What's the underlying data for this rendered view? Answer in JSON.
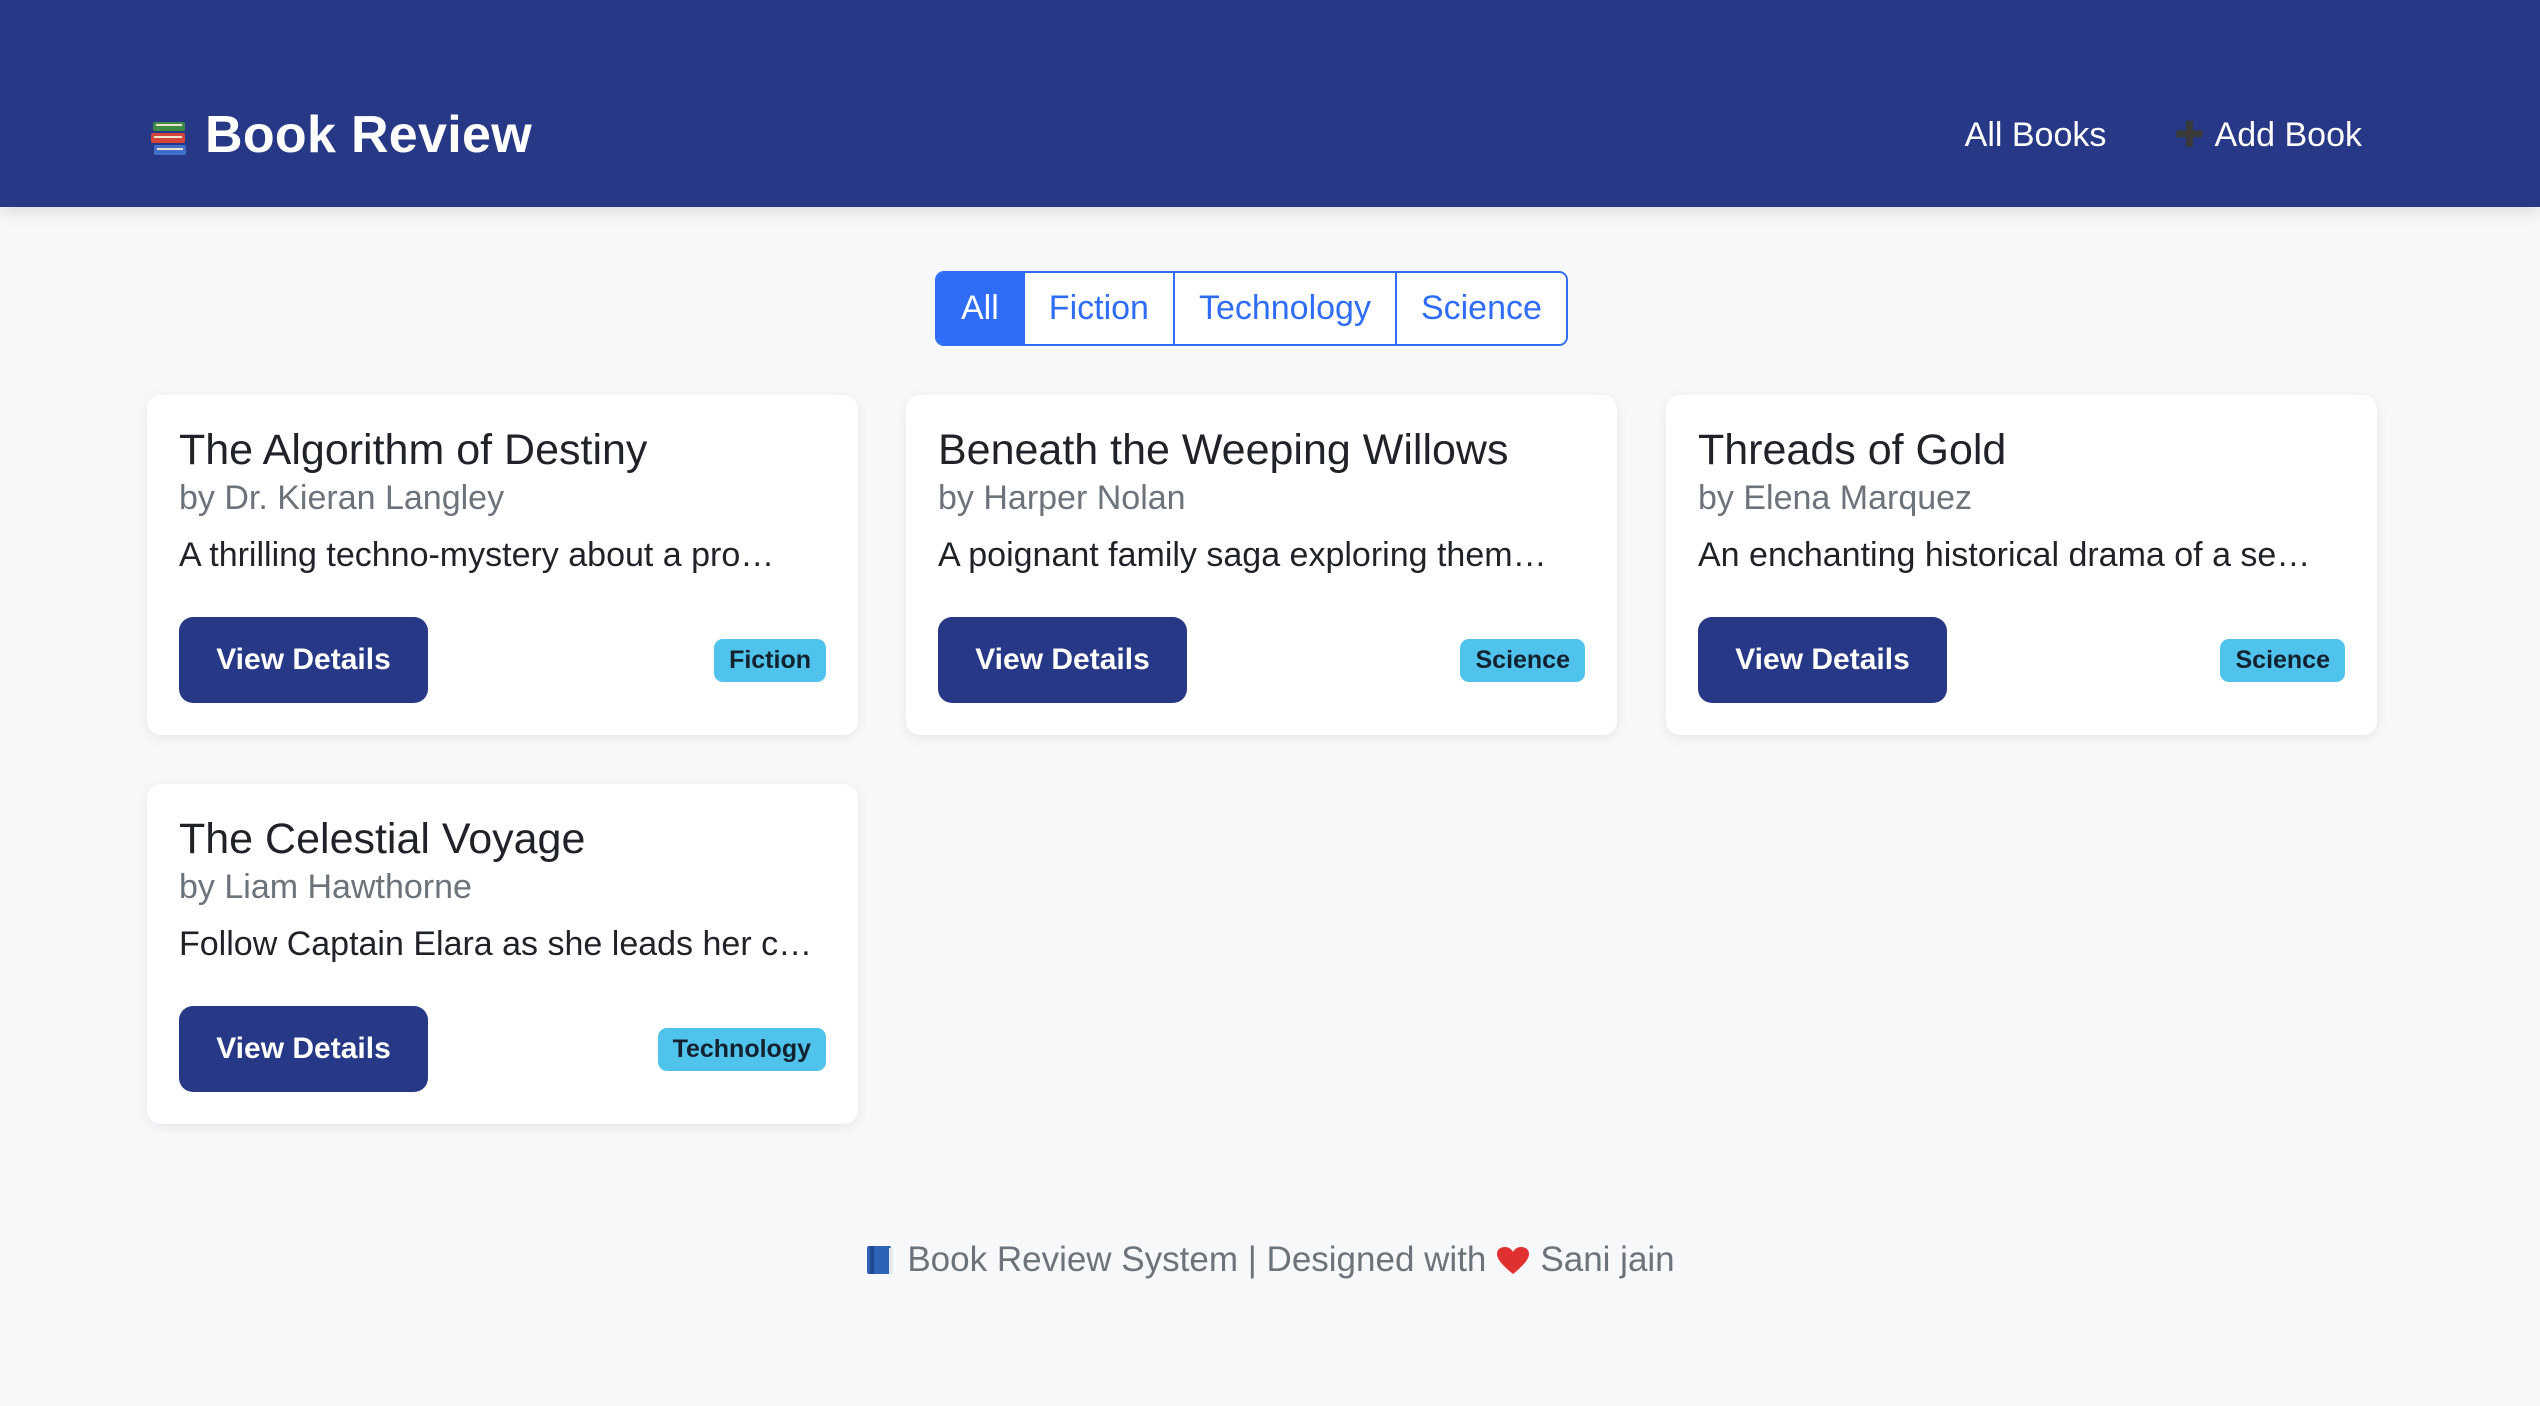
{
  "navbar": {
    "brand": "Book Review",
    "brand_icon": "books-stack-icon",
    "links": [
      {
        "label": "All Books"
      },
      {
        "label": "Add Book",
        "icon": "plus-icon"
      }
    ]
  },
  "filters": {
    "options": [
      "All",
      "Fiction",
      "Technology",
      "Science"
    ],
    "active": "All"
  },
  "books": [
    {
      "title": "The Algorithm of Destiny",
      "author": "by Dr. Kieran Langley",
      "description": "A thrilling techno-mystery about a pro…",
      "button": "View Details",
      "category": "Fiction"
    },
    {
      "title": "Beneath the Weeping Willows",
      "author": "by Harper Nolan",
      "description": "A poignant family saga exploring them…",
      "button": "View Details",
      "category": "Science"
    },
    {
      "title": "Threads of Gold",
      "author": "by Elena Marquez",
      "description": "An enchanting historical drama of a se…",
      "button": "View Details",
      "category": "Science"
    },
    {
      "title": "The Celestial Voyage",
      "author": "by Liam Hawthorne",
      "description": "Follow Captain Elara as she leads her c…",
      "button": "View Details",
      "category": "Technology"
    }
  ],
  "footer": {
    "prefix": "Book Review System | Designed with",
    "suffix": "Sani jain",
    "book_icon": "blue-book-icon",
    "heart_icon": "red-heart-icon"
  },
  "colors": {
    "navbar": "#263886",
    "accent": "#2f6df6",
    "badge": "#4fc3ec",
    "background": "#f7f8fa"
  }
}
